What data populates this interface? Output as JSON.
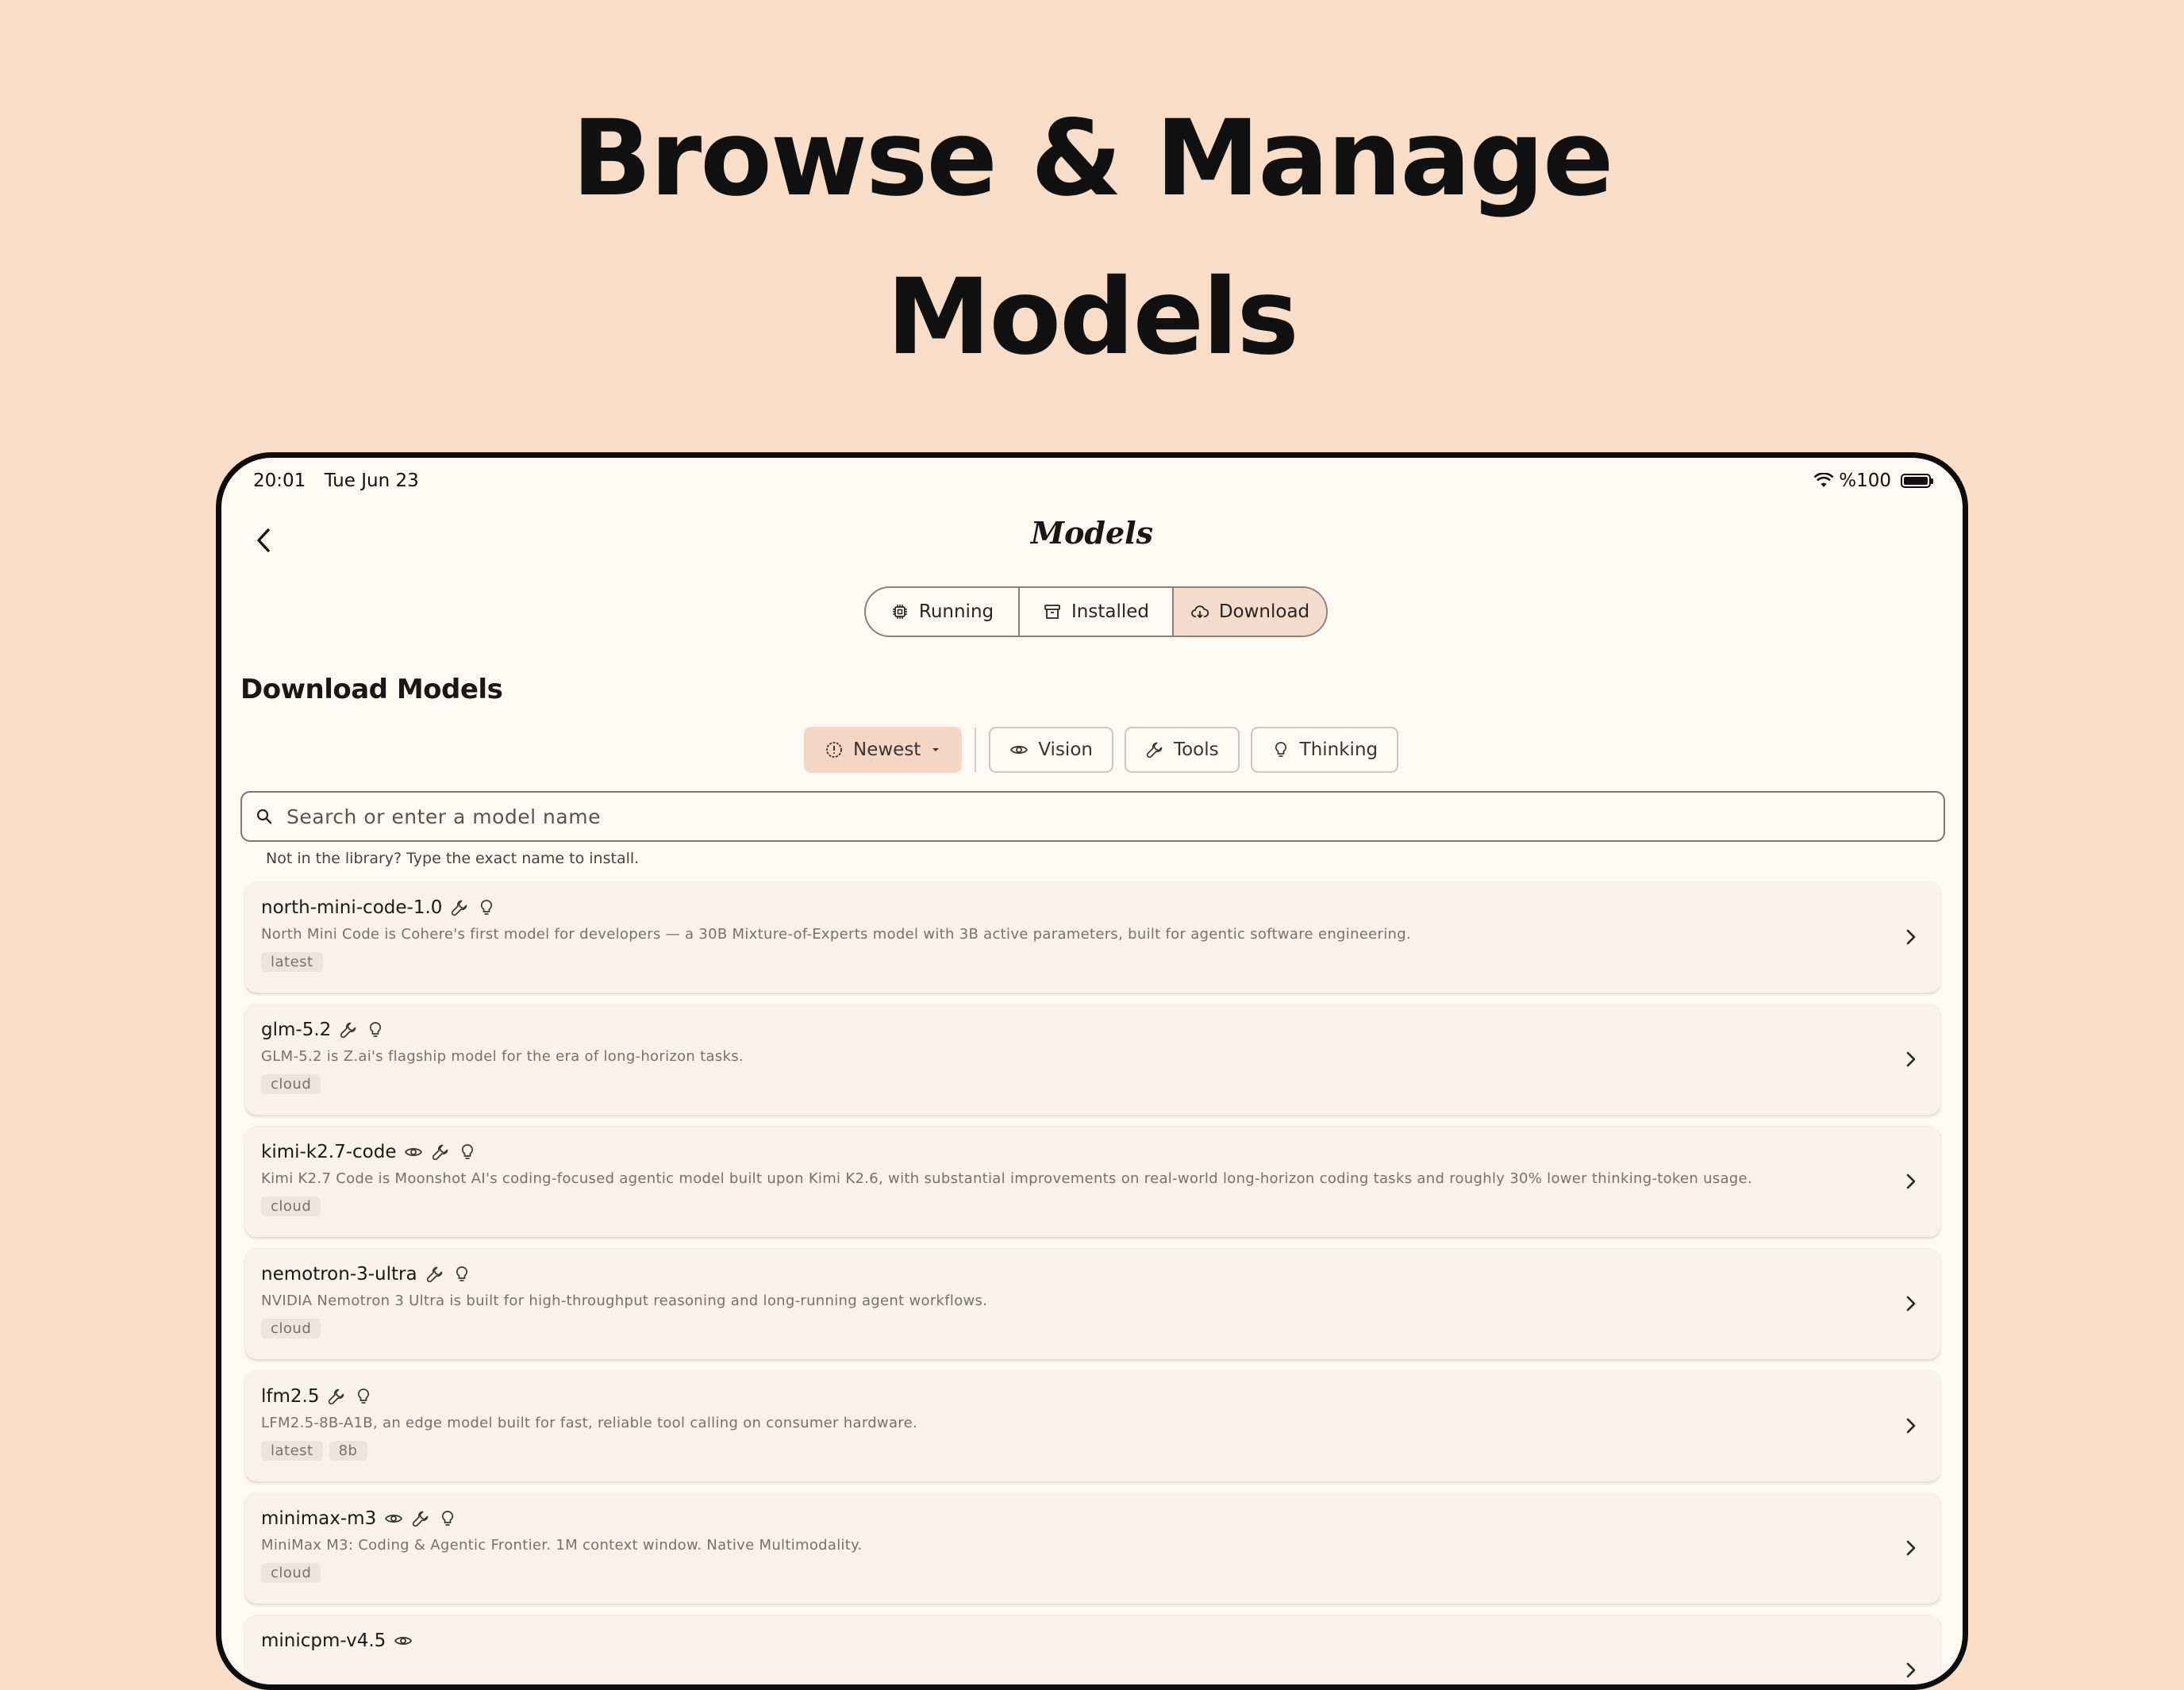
{
  "headline": {
    "line1": "Browse & Manage",
    "line2": "Models"
  },
  "status": {
    "time": "20:01",
    "date": "Tue Jun 23",
    "battery": "%100"
  },
  "nav": {
    "title": "Models"
  },
  "tabs": [
    {
      "label": "Running",
      "icon": "chip-icon"
    },
    {
      "label": "Installed",
      "icon": "archive-icon"
    },
    {
      "label": "Download",
      "icon": "cloud-download-icon",
      "active": true
    }
  ],
  "section": {
    "title": "Download Models"
  },
  "filters": {
    "sort_label": "Newest",
    "chips": [
      "Vision",
      "Tools",
      "Thinking"
    ]
  },
  "search": {
    "placeholder": "Search or enter a model name",
    "hint": "Not in the library? Type the exact name to install."
  },
  "models": [
    {
      "name": "north-mini-code-1.0",
      "desc": "North Mini Code is Cohere's first model for developers — a 30B Mixture-of-Experts model with 3B active parameters, built for agentic software engineering.",
      "tags": [
        "latest"
      ],
      "caps": [
        "tools",
        "thinking"
      ]
    },
    {
      "name": "glm-5.2",
      "desc": "GLM-5.2 is Z.ai's flagship model for the era of long-horizon tasks.",
      "tags": [
        "cloud"
      ],
      "caps": [
        "tools",
        "thinking"
      ]
    },
    {
      "name": "kimi-k2.7-code",
      "desc": "Kimi K2.7 Code is Moonshot AI's coding-focused agentic model built upon Kimi K2.6, with substantial improvements on real-world long-horizon coding tasks and roughly 30% lower thinking-token usage.",
      "tags": [
        "cloud"
      ],
      "caps": [
        "vision",
        "tools",
        "thinking"
      ]
    },
    {
      "name": "nemotron-3-ultra",
      "desc": "NVIDIA Nemotron 3 Ultra is built for high-throughput reasoning and long-running agent workflows.",
      "tags": [
        "cloud"
      ],
      "caps": [
        "tools",
        "thinking"
      ]
    },
    {
      "name": "lfm2.5",
      "desc": "LFM2.5-8B-A1B, an edge model built for fast, reliable tool calling on consumer hardware.",
      "tags": [
        "latest",
        "8b"
      ],
      "caps": [
        "tools",
        "thinking"
      ]
    },
    {
      "name": "minimax-m3",
      "desc": "MiniMax M3: Coding & Agentic Frontier. 1M context window. Native Multimodality.",
      "tags": [
        "cloud"
      ],
      "caps": [
        "vision",
        "tools",
        "thinking"
      ]
    },
    {
      "name": "minicpm-v4.5",
      "desc": "",
      "tags": [],
      "caps": [
        "vision"
      ]
    }
  ]
}
